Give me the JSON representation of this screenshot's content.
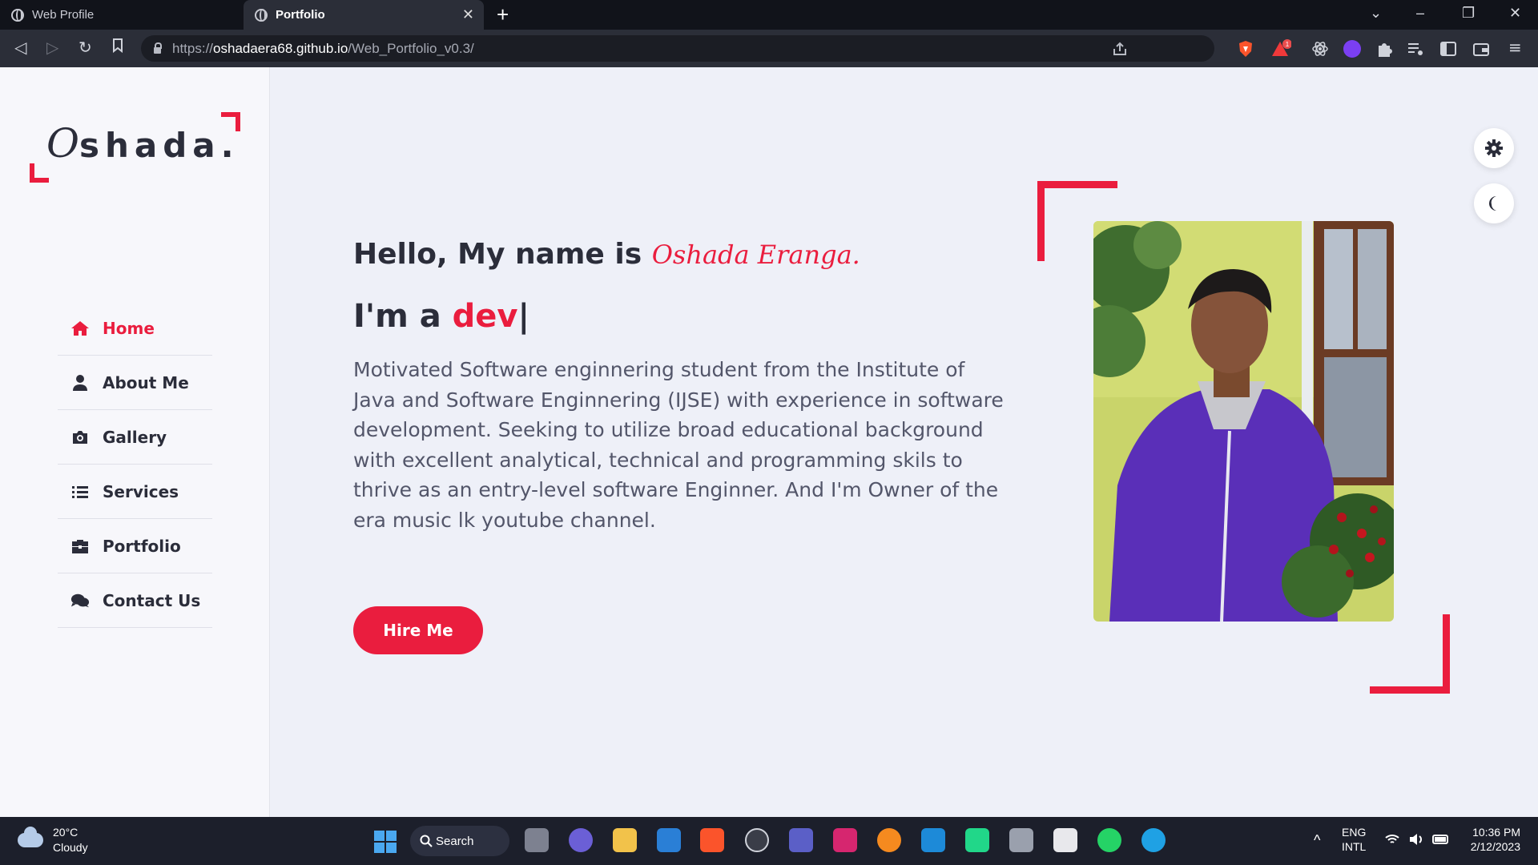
{
  "browser": {
    "tabs": [
      {
        "label": "Web Profile"
      },
      {
        "label": "Portfolio"
      }
    ],
    "new_tab_label": "+",
    "close_label": "✕",
    "url": {
      "protocol": "https://",
      "host": "oshadaera68.github.io",
      "path": "/Web_Portfolio_v0.3/"
    },
    "window_controls": {
      "dropdown": "⌄",
      "minimize": "–",
      "restore": "❐",
      "close": "✕"
    },
    "notification_badge": "1"
  },
  "sidebar": {
    "logo": {
      "initial": "O",
      "rest": "shada."
    },
    "items": [
      {
        "label": "Home",
        "icon": "home-icon",
        "active": true
      },
      {
        "label": "About Me",
        "icon": "user-icon"
      },
      {
        "label": "Gallery",
        "icon": "camera-icon"
      },
      {
        "label": "Services",
        "icon": "list-icon"
      },
      {
        "label": "Portfolio",
        "icon": "briefcase-icon"
      },
      {
        "label": "Contact Us",
        "icon": "comments-icon"
      }
    ]
  },
  "hero": {
    "greeting": "Hello, My name is",
    "name": "Oshada Eranga.",
    "role_prefix": "I'm a",
    "role_typed": "dev",
    "caret": "|",
    "about": "Motivated Software enginnering student from the Institute of Java and Software Enginnering (IJSE) with experience in software development. Seeking to utilize broad educational background with excellent analytical, technical and programming skils to thrive as an entry-level software Enginner. And I'm Owner of the era music lk youtube channel.",
    "hire_label": "Hire Me"
  },
  "colors": {
    "accent": "#ea1d3e",
    "text": "#2b2d3a",
    "muted": "#53566a",
    "page_bg": "#eef0f8"
  },
  "taskbar": {
    "weather": {
      "temp": "20°C",
      "condition": "Cloudy"
    },
    "search_label": "Search",
    "language": {
      "line1": "ENG",
      "line2": "INTL"
    },
    "clock": {
      "time": "10:36 PM",
      "date": "2/12/2023"
    }
  }
}
